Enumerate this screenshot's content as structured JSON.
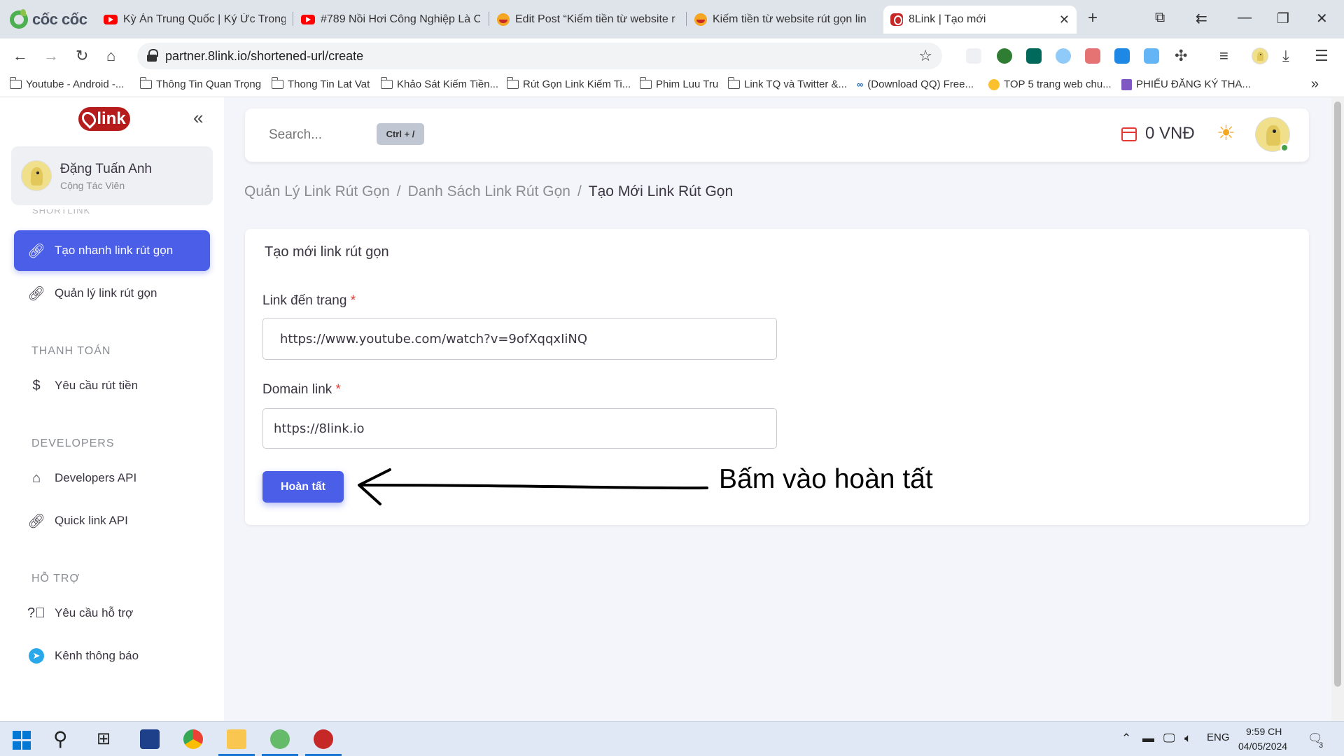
{
  "browser": {
    "brand": "cốc cốc",
    "tabs": [
      {
        "title": "Kỳ Án Trung Quốc | Ký Ức Trong"
      },
      {
        "title": "#789 Nồi Hơi Công Nghiệp Là C"
      },
      {
        "title": "Edit Post “Kiếm tiền từ website r"
      },
      {
        "title": "Kiếm tiền từ website rút gọn lin"
      },
      {
        "title": "8Link | Tạo mới"
      }
    ],
    "url": "partner.8link.io/shortened-url/create",
    "bookmarks": [
      "Youtube - Android -...",
      "Thông Tin Quan Trọng",
      "Thong Tin Lat Vat",
      "Khảo Sát Kiếm Tiền...",
      "Rút Gọn Link Kiếm Ti...",
      "Phim Luu Tru",
      "Link TQ và Twitter &...",
      "(Download QQ) Free...",
      "TOP 5 trang web chu...",
      "PHIẾU ĐĂNG KÝ THA..."
    ]
  },
  "sidebar": {
    "brand": "link",
    "user": {
      "name": "Đặng Tuấn Anh",
      "role": "Cộng Tác Viên"
    },
    "section_shortlink": "SHORTLINK",
    "items": [
      {
        "label": "Tạo nhanh link rút gọn"
      },
      {
        "label": "Quản lý link rút gọn"
      },
      {
        "label": "Yêu cầu rút tiền"
      },
      {
        "label": "Developers API"
      },
      {
        "label": "Quick link API"
      },
      {
        "label": "Yêu cầu hỗ trợ"
      },
      {
        "label": "Kênh thông báo"
      }
    ],
    "sections": {
      "payment": "THANH TOÁN",
      "developers": "DEVELOPERS",
      "support": "HỖ TRỢ"
    }
  },
  "header": {
    "search_placeholder": "Search...",
    "shortcut": "Ctrl + /",
    "balance": "0 VNĐ"
  },
  "breadcrumb": {
    "items": [
      "Quản Lý Link Rút Gọn",
      "Danh Sách Link Rút Gọn"
    ],
    "current": "Tạo Mới Link Rút Gọn",
    "separator": "/"
  },
  "form": {
    "title": "Tạo mới link rút gọn",
    "link_label": "Link đến trang",
    "link_value": "https://www.youtube.com/watch?v=9ofXqqxIiNQ",
    "domain_label": "Domain link",
    "domain_value": "https://8link.io",
    "required_mark": "*",
    "submit": "Hoàn tất"
  },
  "annotation": {
    "text": "Bấm vào hoàn tất"
  },
  "taskbar": {
    "lang": "ENG",
    "time": "9:59 CH",
    "date": "04/05/2024",
    "notifications": "3"
  },
  "colors": {
    "accent": "#4b5ee8",
    "brand": "#b71c1c",
    "required": "#e53935"
  }
}
